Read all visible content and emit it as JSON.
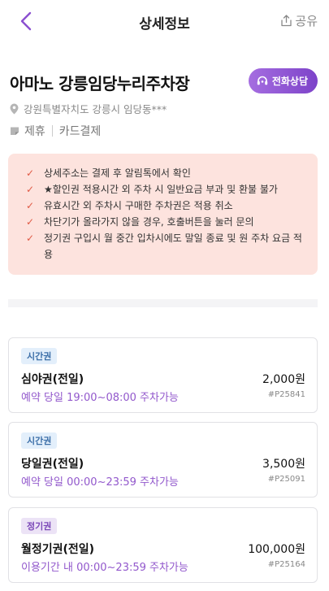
{
  "header": {
    "title": "상세정보",
    "share_label": "공유"
  },
  "lot": {
    "name": "아마노 강릉임당누리주차장",
    "call_label": "전화상담",
    "address": "강원특별자치도 강릉시 임당동***",
    "payment_methods": [
      "제휴",
      "카드결제"
    ]
  },
  "notices": [
    "상세주소는 결제 후 알림톡에서 확인",
    "★할인권 적용시간 외 주차 시 일반요금 부과 및 환불 불가",
    "유효시간 외 주차시 구매한 주차권은 적용 취소",
    "차단기가 올라가지 않을 경우, 호출버튼을 눌러 문의",
    "정기권 구입시 월 중간 입차시에도 말일 종료 및 원 주차 요금 적용"
  ],
  "tickets": [
    {
      "badge": "시간권",
      "name": "심야권(전일)",
      "price": "2,000원",
      "hours": "예약 당일 19:00~08:00 주차가능",
      "code": "#P25841"
    },
    {
      "badge": "시간권",
      "name": "당일권(전일)",
      "price": "3,500원",
      "hours": "예약 당일 00:00~23:59 주차가능",
      "code": "#P25091"
    },
    {
      "badge": "정기권",
      "name": "월정기권(전일)",
      "price": "100,000원",
      "hours": "이용기간 내 00:00~23:59 주차가능",
      "code": "#P25164"
    }
  ],
  "colors": {
    "accent": "#8b4fd0",
    "notice_bg": "#fde3de",
    "check": "#e05a45"
  }
}
